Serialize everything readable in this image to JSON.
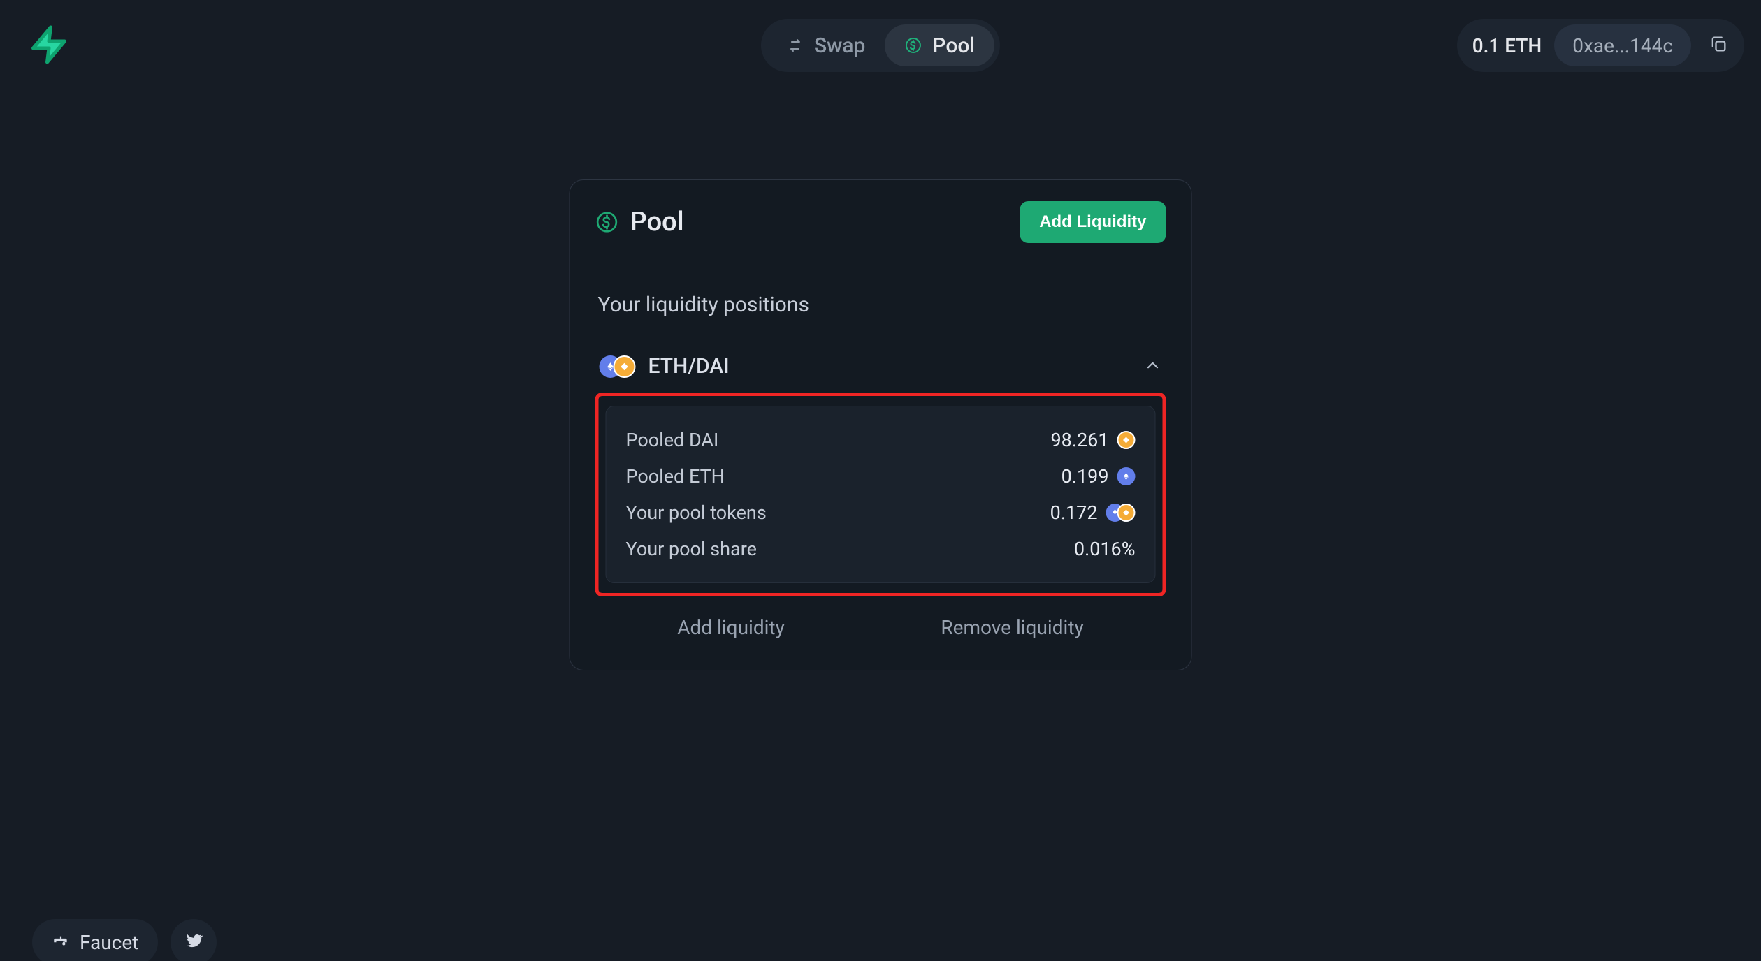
{
  "header": {
    "tabs": {
      "swap": "Swap",
      "pool": "Pool"
    },
    "wallet": {
      "balance": "0.1 ETH",
      "address": "0xae...144c"
    }
  },
  "card": {
    "title": "Pool",
    "add_label": "Add Liquidity",
    "section_title": "Your liquidity positions",
    "pair_label": "ETH/DAI",
    "details": {
      "pooled_dai": {
        "label": "Pooled DAI",
        "value": "98.261"
      },
      "pooled_eth": {
        "label": "Pooled ETH",
        "value": "0.199"
      },
      "pool_tokens": {
        "label": "Your pool tokens",
        "value": "0.172"
      },
      "pool_share": {
        "label": "Your pool share",
        "value": "0.016%"
      }
    },
    "actions": {
      "add": "Add liquidity",
      "remove": "Remove liquidity"
    }
  },
  "bottom": {
    "faucet": "Faucet"
  }
}
